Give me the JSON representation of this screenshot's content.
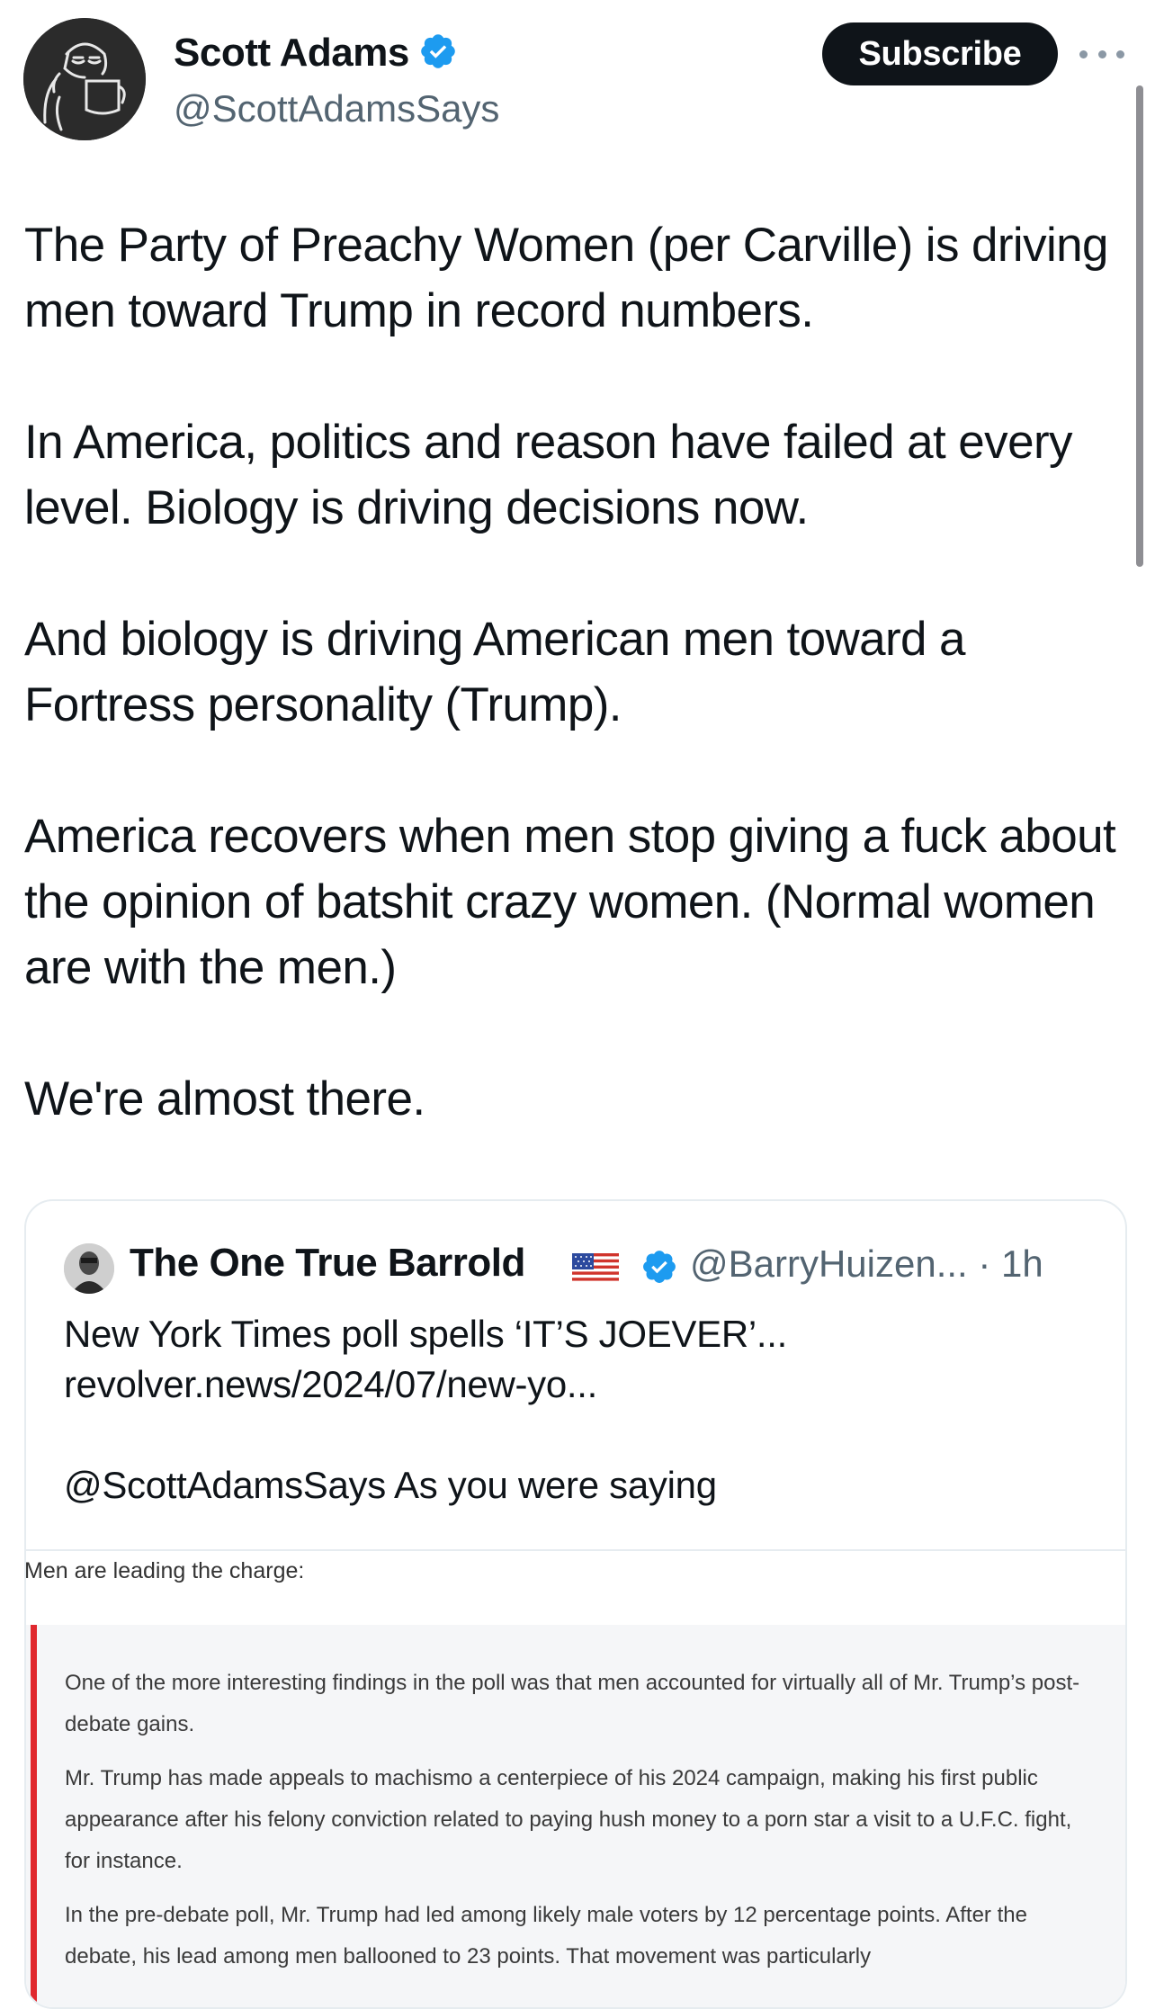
{
  "tweet": {
    "author_name": "Scott Adams",
    "author_handle": "@ScottAdamsSays",
    "subscribe_label": "Subscribe",
    "paragraphs": [
      "The Party of Preachy Women (per Carville) is driving men toward Trump in record numbers.",
      "In America, politics and reason have failed at every level. Biology is driving decisions now.",
      "And biology is driving American men toward a Fortress personality (Trump).",
      "America recovers when men stop giving a fuck about the opinion of batshit crazy women. (Normal women are with the men.)",
      "We're almost there."
    ]
  },
  "quote": {
    "author_name": "The One True Barrold",
    "flag": "🇺🇸",
    "handle_time": "@BarryHuizen... · 1h",
    "line1": "New York Times poll spells ‘IT’S JOEVER’...",
    "line2": "revolver.news/2024/07/new-yo...",
    "line3": "@ScottAdamsSays As you were saying"
  },
  "article": {
    "intro": "Men are leading the charge:",
    "quote_paragraphs": [
      "One of the more interesting findings in the poll was that men accounted for virtually all of Mr. Trump’s post-debate gains.",
      "Mr. Trump has made appeals to machismo a centerpiece of his 2024 campaign, making his first public appearance after his felony conviction related to paying hush money to a porn star a visit to a U.F.C. fight, for instance.",
      "In the pre-debate poll, Mr. Trump had led among likely male voters by 12 percentage points. After the debate, his lead among men ballooned to 23 points. That movement was particularly"
    ],
    "accent_color": "#e0282e"
  },
  "colors": {
    "verified": "#1d9bf0",
    "secondary_text": "#536471",
    "primary_text": "#0f1419"
  }
}
